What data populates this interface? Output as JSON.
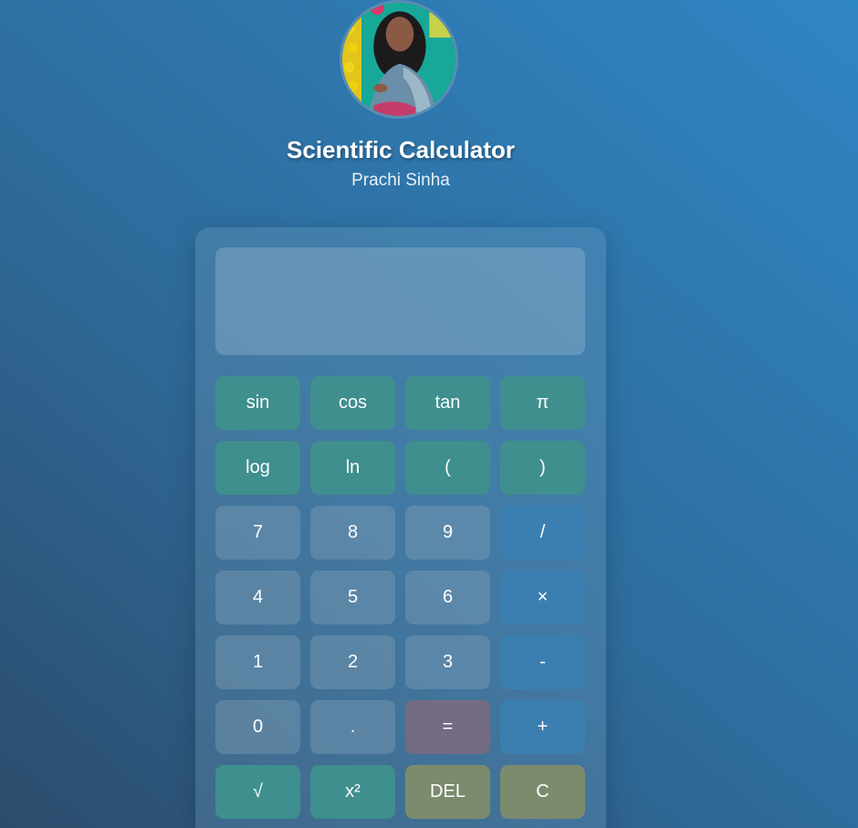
{
  "header": {
    "title": "Scientific Calculator",
    "subtitle": "Prachi Sinha",
    "avatar_icon": "profile-photo"
  },
  "display": {
    "value": ""
  },
  "keys": [
    {
      "label": "sin",
      "kind": "fn"
    },
    {
      "label": "cos",
      "kind": "fn"
    },
    {
      "label": "tan",
      "kind": "fn"
    },
    {
      "label": "π",
      "kind": "fn"
    },
    {
      "label": "log",
      "kind": "fn"
    },
    {
      "label": "ln",
      "kind": "fn"
    },
    {
      "label": "(",
      "kind": "fn"
    },
    {
      "label": ")",
      "kind": "fn"
    },
    {
      "label": "7",
      "kind": "num"
    },
    {
      "label": "8",
      "kind": "num"
    },
    {
      "label": "9",
      "kind": "num"
    },
    {
      "label": "/",
      "kind": "op"
    },
    {
      "label": "4",
      "kind": "num"
    },
    {
      "label": "5",
      "kind": "num"
    },
    {
      "label": "6",
      "kind": "num"
    },
    {
      "label": "×",
      "kind": "op"
    },
    {
      "label": "1",
      "kind": "num"
    },
    {
      "label": "2",
      "kind": "num"
    },
    {
      "label": "3",
      "kind": "num"
    },
    {
      "label": "-",
      "kind": "op"
    },
    {
      "label": "0",
      "kind": "num"
    },
    {
      "label": ".",
      "kind": "num"
    },
    {
      "label": "=",
      "kind": "eq"
    },
    {
      "label": "+",
      "kind": "op"
    },
    {
      "label": "√",
      "kind": "fn"
    },
    {
      "label": "x²",
      "kind": "fn"
    },
    {
      "label": "DEL",
      "kind": "warn"
    },
    {
      "label": "C",
      "kind": "warn"
    }
  ],
  "colors": {
    "function_key": "#3e8f8e",
    "number_key": "#6f8fab",
    "operator_key": "#3b7fb0",
    "equals_key": "#756b82",
    "clear_key": "#7c8a6e"
  }
}
